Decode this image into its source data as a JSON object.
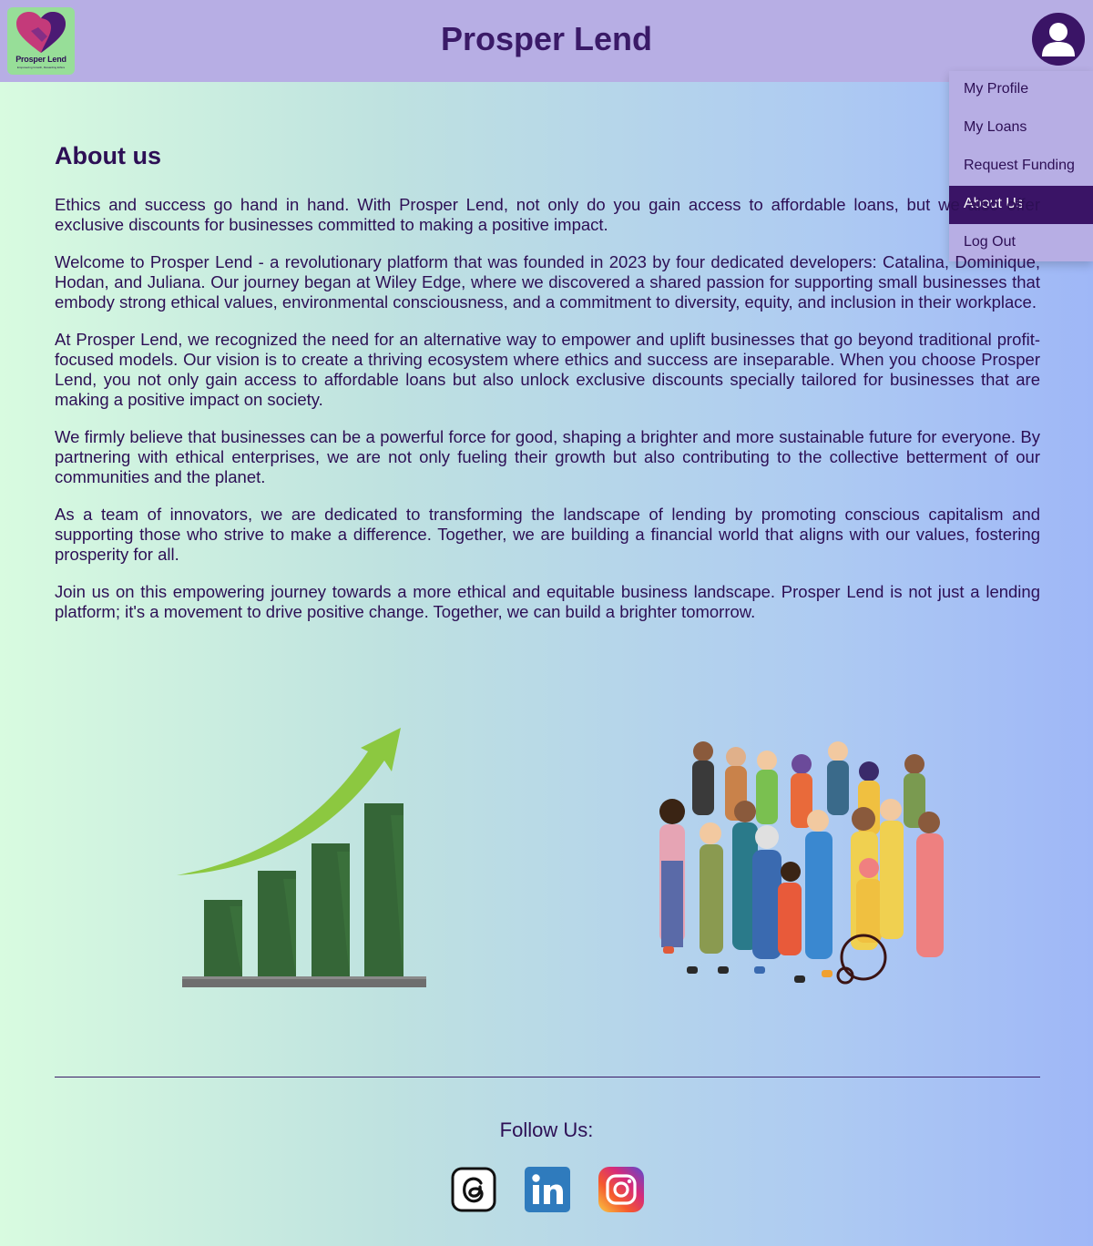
{
  "header": {
    "title": "Prosper Lend",
    "logo": {
      "name": "Prosper Lend",
      "tagline": "Empowering Growth, Rewarding Ethics"
    }
  },
  "menu": {
    "items": [
      {
        "label": "My Profile"
      },
      {
        "label": "My Loans"
      },
      {
        "label": "Request Funding"
      },
      {
        "label": "About Us",
        "active": true
      },
      {
        "label": "Log Out"
      }
    ]
  },
  "about": {
    "heading": "About us",
    "paragraphs": [
      "Ethics and success go hand in hand. With Prosper Lend, not only do you gain access to affordable loans, but we also offer exclusive discounts for businesses committed to making a positive impact.",
      "Welcome to Prosper Lend - a revolutionary platform that was founded in 2023 by four dedicated developers: Catalina, Dominique, Hodan, and Juliana. Our journey began at Wiley Edge, where we discovered a shared passion for supporting small businesses that embody strong ethical values, environmental consciousness, and a commitment to diversity, equity, and inclusion in their workplace.",
      "At Prosper Lend, we recognized the need for an alternative way to empower and uplift businesses that go beyond traditional profit-focused models. Our vision is to create a thriving ecosystem where ethics and success are inseparable. When you choose Prosper Lend, you not only gain access to affordable loans but also unlock exclusive discounts specially tailored for businesses that are making a positive impact on society.",
      "We firmly believe that businesses can be a powerful force for good, shaping a brighter and more sustainable future for everyone. By partnering with ethical enterprises, we are not only fueling their growth but also contributing to the collective betterment of our communities and the planet.",
      "As a team of innovators, we are dedicated to transforming the landscape of lending by promoting conscious capitalism and supporting those who strive to make a difference. Together, we are building a financial world that aligns with our values, fostering prosperity for all.",
      "Join us on this empowering journey towards a more ethical and equitable business landscape. Prosper Lend is not just a lending platform; it's a movement to drive positive change. Together, we can build a brighter tomorrow."
    ]
  },
  "footer": {
    "follow_label": "Follow Us:",
    "social": [
      "threads-icon",
      "linkedin-icon",
      "instagram-icon"
    ]
  },
  "colors": {
    "header_bg": "#b7aee4",
    "brand_purple": "#3a1466",
    "text": "#2d0f55",
    "logo_bg": "#97de98"
  }
}
